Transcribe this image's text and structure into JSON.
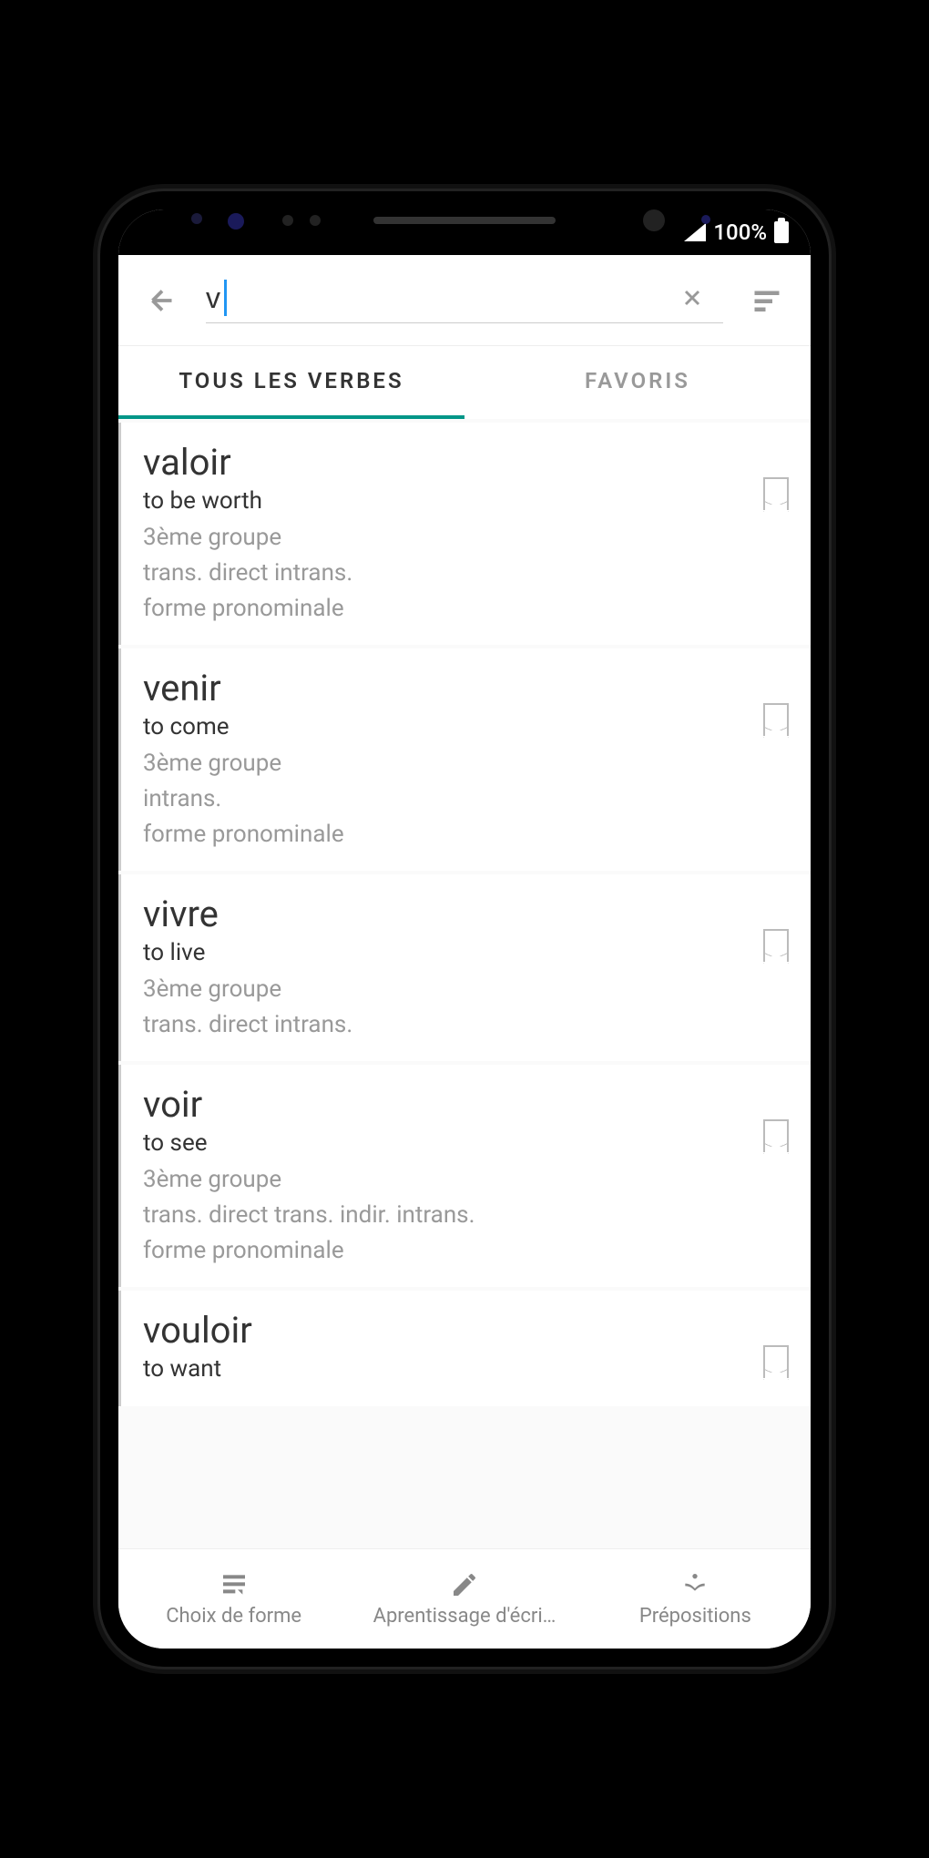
{
  "status": {
    "battery": "100%"
  },
  "search": {
    "value": "v"
  },
  "tabs": {
    "all": "TOUS LES VERBES",
    "favorites": "FAVORIS"
  },
  "verbs": [
    {
      "name": "valoir",
      "translation": "to be worth",
      "group": "3ème groupe",
      "transitivity": "trans. direct   intrans.",
      "form": "forme pronominale"
    },
    {
      "name": "venir",
      "translation": "to come",
      "group": "3ème groupe",
      "transitivity": "intrans.",
      "form": "forme pronominale"
    },
    {
      "name": "vivre",
      "translation": "to live",
      "group": "3ème groupe",
      "transitivity": "trans. direct   intrans.",
      "form": ""
    },
    {
      "name": "voir",
      "translation": "to see",
      "group": "3ème groupe",
      "transitivity": "trans. direct   trans. indir.   intrans.",
      "form": "forme pronominale"
    },
    {
      "name": "vouloir",
      "translation": "to want",
      "group": "",
      "transitivity": "",
      "form": ""
    }
  ],
  "nav": {
    "form": "Choix de forme",
    "writing": "Aprentissage d'écri…",
    "prepositions": "Prépositions"
  }
}
